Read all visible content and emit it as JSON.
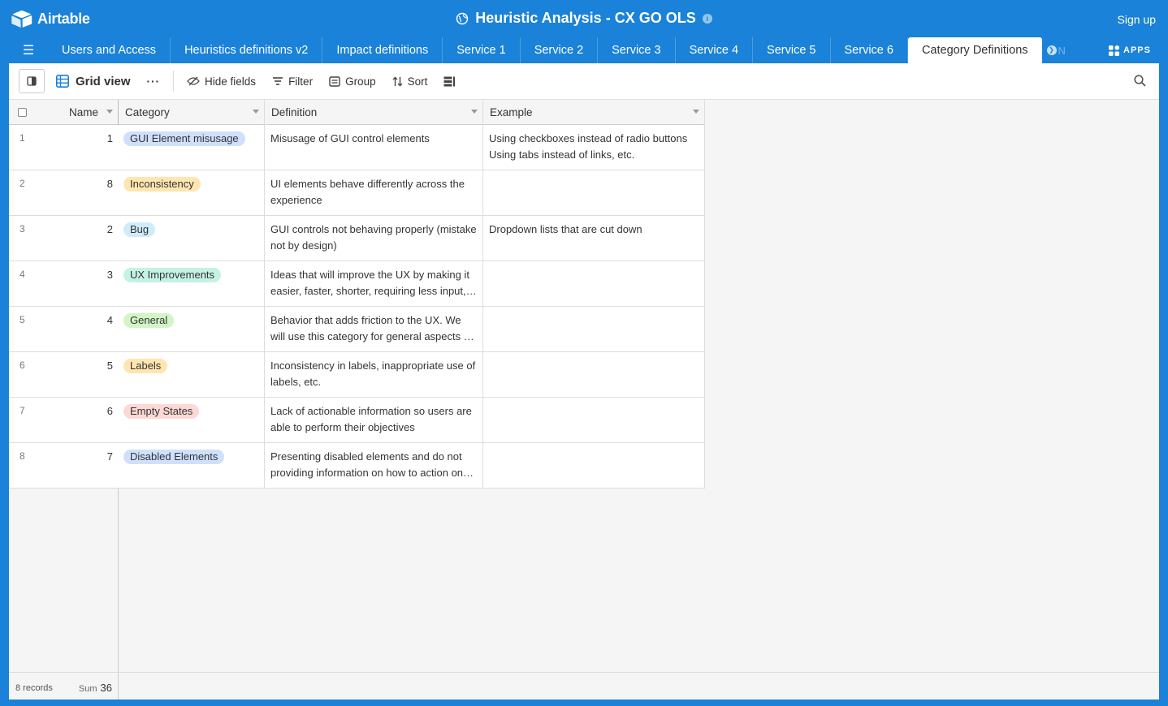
{
  "app": {
    "logo_text": "Airtable",
    "base_title": "Heuristic Analysis - CX GO OLS",
    "signup_label": "Sign up"
  },
  "tabs": [
    {
      "label": "Users and Access"
    },
    {
      "label": "Heuristics definitions v2"
    },
    {
      "label": "Impact definitions"
    },
    {
      "label": "Service 1"
    },
    {
      "label": "Service 2"
    },
    {
      "label": "Service 3"
    },
    {
      "label": "Service 4"
    },
    {
      "label": "Service 5"
    },
    {
      "label": "Service 6"
    },
    {
      "label": "Category Definitions",
      "active": true
    }
  ],
  "tab_overflow_text": "N",
  "apps_label": "APPS",
  "toolbar": {
    "view_name": "Grid view",
    "more_label": "···",
    "hide_fields": "Hide fields",
    "filter": "Filter",
    "group": "Group",
    "sort": "Sort"
  },
  "columns": {
    "name": "Name",
    "category": "Category",
    "definition": "Definition",
    "example": "Example"
  },
  "rows": [
    {
      "num": "1",
      "name": "1",
      "category": "GUI Element misusage",
      "cat_bg": "#cfe0fd",
      "definition": "Misusage of GUI control elements",
      "example": "Using checkboxes instead of radio buttons Using tabs instead of links, etc."
    },
    {
      "num": "2",
      "name": "8",
      "category": "Inconsistency",
      "cat_bg": "#ffe6b0",
      "definition": "UI elements behave differently across the experience",
      "example": ""
    },
    {
      "num": "3",
      "name": "2",
      "category": "Bug",
      "cat_bg": "#d0ecfa",
      "definition": "GUI controls not behaving properly (mistake not by design)",
      "example": "Dropdown lists that are cut down"
    },
    {
      "num": "4",
      "name": "3",
      "category": "UX Improvements",
      "cat_bg": "#c4f2e4",
      "definition": "Ideas that will improve the UX by making it easier, faster, shorter, requiring less input, etc.",
      "example": ""
    },
    {
      "num": "5",
      "name": "4",
      "category": "General",
      "cat_bg": "#d1f5c6",
      "definition": "Behavior that adds friction to the UX. We will use this category for general aspects of the experience",
      "example": ""
    },
    {
      "num": "6",
      "name": "5",
      "category": "Labels",
      "cat_bg": "#ffe6b0",
      "definition": "Inconsistency in labels, inappropriate use of labels, etc.",
      "example": ""
    },
    {
      "num": "7",
      "name": "6",
      "category": "Empty States",
      "cat_bg": "#fcd9d4",
      "definition": "Lack of actionable information so users are able to perform their objectives",
      "example": ""
    },
    {
      "num": "8",
      "name": "7",
      "category": "Disabled Elements",
      "cat_bg": "#cfe0fd",
      "definition": "Presenting disabled elements and do not providing information on how to action on them",
      "example": ""
    }
  ],
  "footer": {
    "records": "8 records",
    "sum_label": "Sum",
    "sum_value": "36"
  }
}
